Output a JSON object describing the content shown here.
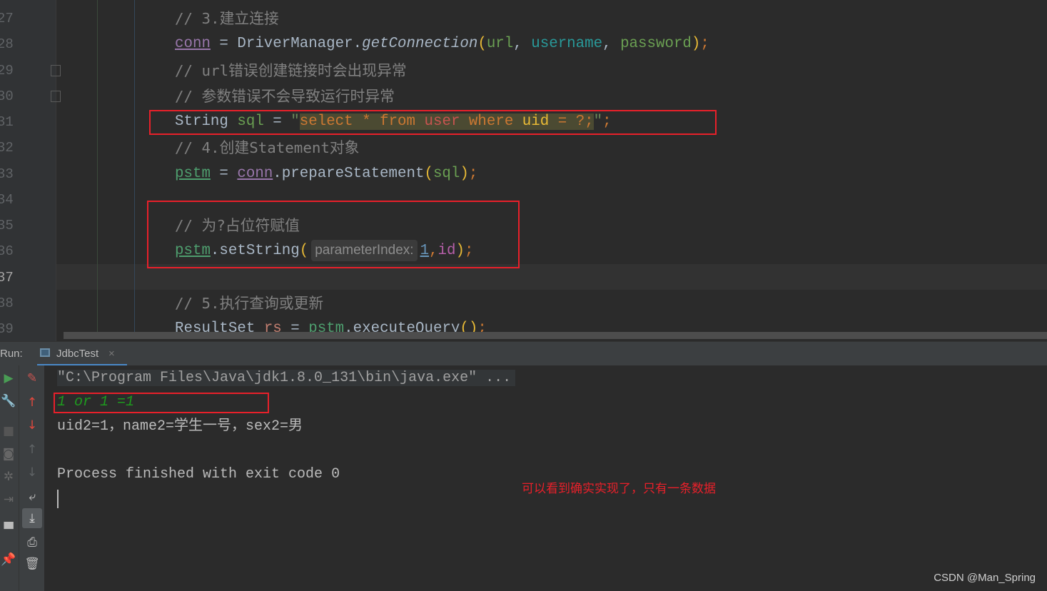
{
  "editor": {
    "line_numbers": [
      "27",
      "28",
      "29",
      "30",
      "31",
      "32",
      "33",
      "34",
      "35",
      "36",
      "37",
      "38",
      "39"
    ],
    "current_line": "37",
    "lines": [
      [
        {
          "t": "// 3.建立连接",
          "c": "cm"
        }
      ],
      [
        {
          "t": "conn",
          "c": "fld"
        },
        {
          "t": " = DriverManager."
        },
        {
          "t": "getConnection",
          "c": "ital"
        },
        {
          "t": "(",
          "c": "par"
        },
        {
          "t": "url",
          "c": "var"
        },
        {
          "t": ", "
        },
        {
          "t": "username",
          "c": "teal"
        },
        {
          "t": ", "
        },
        {
          "t": "password",
          "c": "var"
        },
        {
          "t": ")",
          "c": "par"
        },
        {
          "t": ";",
          "c": "kw"
        }
      ],
      [
        {
          "t": "// url错误创建链接时会出现异常",
          "c": "cm"
        }
      ],
      [
        {
          "t": "// 参数错误不会导致运行时异常",
          "c": "cm"
        }
      ],
      [
        {
          "t": "String "
        },
        {
          "t": "sql",
          "c": "var"
        },
        {
          "t": " = "
        },
        {
          "t": "\"",
          "c": "str"
        },
        {
          "t": "select * from ",
          "c": "kw sqlbg"
        },
        {
          "t": "user",
          "c": "tbl sqlbg"
        },
        {
          "t": " where ",
          "c": "kw sqlbg"
        },
        {
          "t": "uid",
          "c": "par sqlbg"
        },
        {
          "t": " = ?;",
          "c": "kw sqlbg"
        },
        {
          "t": "\"",
          "c": "str"
        },
        {
          "t": ";",
          "c": "kw"
        }
      ],
      [
        {
          "t": "// 4.创建Statement对象",
          "c": "cm"
        }
      ],
      [
        {
          "t": "pstm",
          "c": "fldg"
        },
        {
          "t": " = "
        },
        {
          "t": "conn",
          "c": "fld"
        },
        {
          "t": ".prepareStatement"
        },
        {
          "t": "(",
          "c": "par"
        },
        {
          "t": "sql",
          "c": "var"
        },
        {
          "t": ")",
          "c": "par"
        },
        {
          "t": ";",
          "c": "kw"
        }
      ],
      [],
      [
        {
          "t": "// 为?占位符赋值",
          "c": "cm"
        }
      ],
      [
        {
          "t": "pstm",
          "c": "fldg"
        },
        {
          "t": ".setString"
        },
        {
          "t": "(",
          "c": "par"
        },
        {
          "t": "parameterIndex:",
          "c": "hint"
        },
        {
          "t": "1",
          "c": "num"
        },
        {
          "t": ",",
          "c": "kw"
        },
        {
          "t": "id",
          "c": "idv"
        },
        {
          "t": ")",
          "c": "par"
        },
        {
          "t": ";",
          "c": "kw"
        }
      ],
      [],
      [
        {
          "t": "// 5.执行查询或更新",
          "c": "cm"
        }
      ],
      [
        {
          "t": "ResultSet "
        },
        {
          "t": "rs",
          "c": "rs"
        },
        {
          "t": " = "
        },
        {
          "t": "pstm",
          "c": "fldg"
        },
        {
          "t": ".executeQuery"
        },
        {
          "t": "()",
          "c": "par"
        },
        {
          "t": ";",
          "c": "kw"
        }
      ]
    ]
  },
  "run_panel": {
    "label": "Run:",
    "tab": "JdbcTest",
    "tab_close": "×",
    "console": {
      "command": "\"C:\\Program Files\\Java\\jdk1.8.0_131\\bin\\java.exe\" ...",
      "input_echo": "1 or 1 =1",
      "result": "uid2=1，name2=学生一号，sex2=男",
      "exit": "Process finished with exit code 0"
    }
  },
  "annotation": "可以看到确实实现了，只有一条数据",
  "watermark": "CSDN @Man_Spring",
  "colors": {
    "accent_red": "#e8202a",
    "console_input": "#1e9a1e",
    "editor_bg": "#2b2b2b",
    "panel_bg": "#3c3f41"
  }
}
